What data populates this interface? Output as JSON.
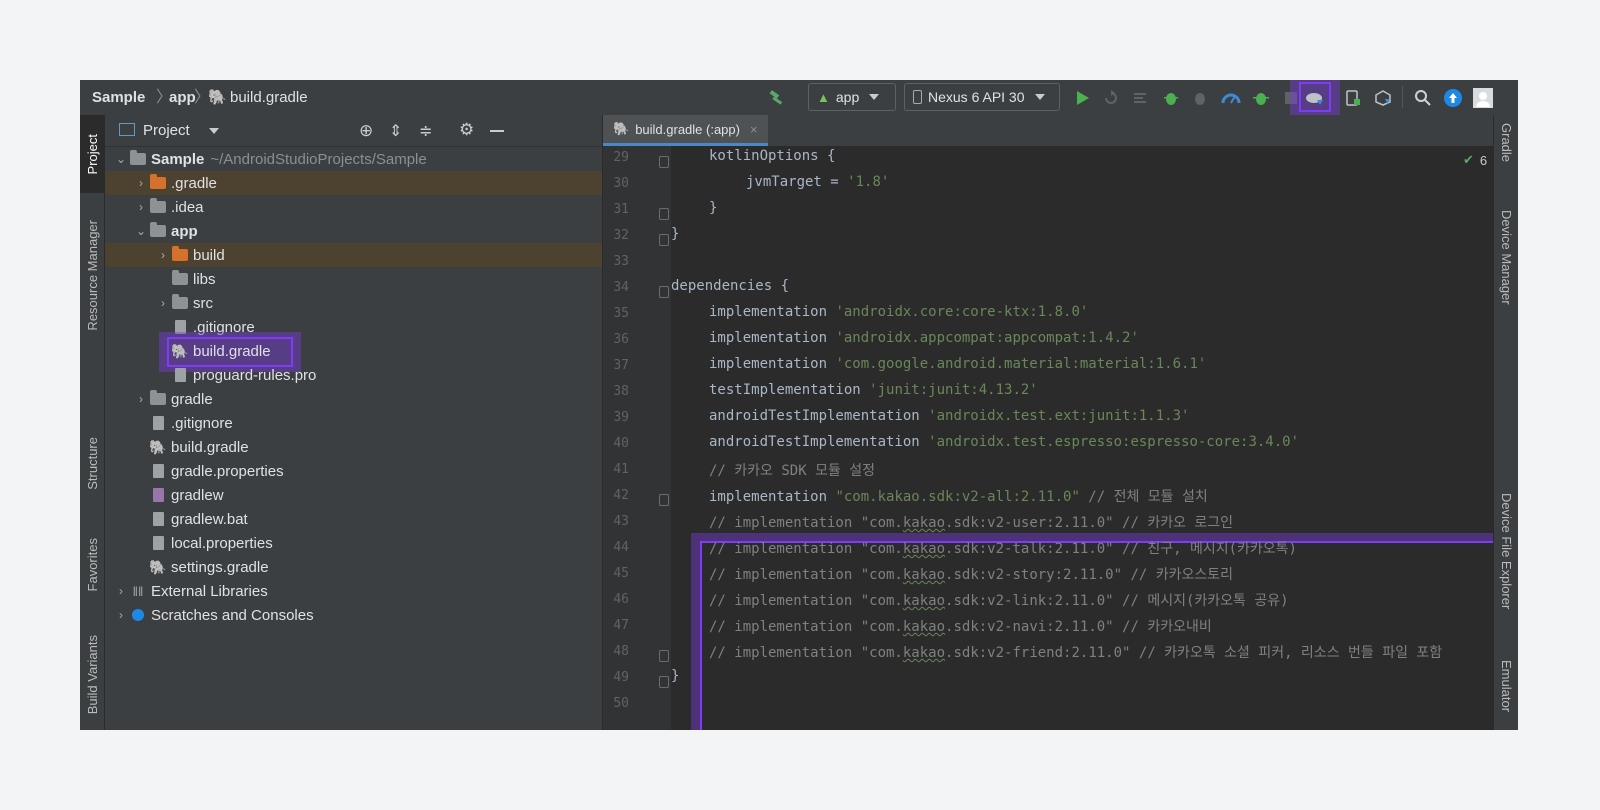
{
  "breadcrumbs": [
    "Sample",
    "app",
    "build.gradle"
  ],
  "toolbar": {
    "config_label": "app",
    "device_label": "Nexus 6 API 30"
  },
  "project_panel": {
    "title": "Project",
    "root": {
      "name": "Sample",
      "path": "~/AndroidStudioProjects/Sample"
    },
    "items": [
      {
        "label": ".gradle"
      },
      {
        "label": ".idea"
      },
      {
        "label": "app"
      },
      {
        "label": "build"
      },
      {
        "label": "libs"
      },
      {
        "label": "src"
      },
      {
        "label": ".gitignore"
      },
      {
        "label": "build.gradle"
      },
      {
        "label": "proguard-rules.pro"
      },
      {
        "label": "gradle"
      },
      {
        "label": ".gitignore"
      },
      {
        "label": "build.gradle"
      },
      {
        "label": "gradle.properties"
      },
      {
        "label": "gradlew"
      },
      {
        "label": "gradlew.bat"
      },
      {
        "label": "local.properties"
      },
      {
        "label": "settings.gradle"
      },
      {
        "label": "External Libraries"
      },
      {
        "label": "Scratches and Consoles"
      }
    ]
  },
  "left_tabs": [
    "Project",
    "Resource Manager",
    "Structure",
    "Favorites",
    "Build Variants"
  ],
  "right_tabs": [
    "Gradle",
    "Device Manager",
    "Device File Explorer",
    "Emulator"
  ],
  "editor": {
    "tab_label": "build.gradle (:app)",
    "inspection_count": "6",
    "line_numbers": [
      "29",
      "30",
      "31",
      "32",
      "33",
      "34",
      "35",
      "36",
      "37",
      "38",
      "39",
      "40",
      "41",
      "42",
      "43",
      "44",
      "45",
      "46",
      "47",
      "48",
      "49",
      "50"
    ],
    "lines": {
      "l29": "kotlinOptions {",
      "l30a": "jvmTarget = ",
      "l30b": "'1.8'",
      "l31": "}",
      "l32": "}",
      "l34": "dependencies {",
      "l35a": "implementation ",
      "l35b": "'androidx.core:core-ktx:1.8.0'",
      "l36a": "implementation ",
      "l36b": "'androidx.appcompat:appcompat:1.4.2'",
      "l37a": "implementation ",
      "l37b": "'com.google.android.material:material:1.6.1'",
      "l38a": "testImplementation ",
      "l38b": "'junit:junit:4.13.2'",
      "l39a": "androidTestImplementation ",
      "l39b": "'androidx.test.ext:junit:1.1.3'",
      "l40a": "androidTestImplementation ",
      "l40b": "'androidx.test.espresso:espresso-core:3.4.0'",
      "l41": "// 카카오 SDK 모듈 설정",
      "l42a": "implementation ",
      "l42b": "\"com.kakao.sdk:v2-all:2.11.0\"",
      "l42c": " // 전체 모듈 설치",
      "l43a": "// implementation \"com.",
      "l43b": "kakao",
      "l43c": ".sdk:v2-user:2.11.0\" // 카카오 로그인",
      "l44a": "// implementation \"com.",
      "l44b": "kakao",
      "l44c": ".sdk:v2-talk:2.11.0\" // 친구, 메시지(카카오톡)",
      "l45a": "// implementation \"com.",
      "l45b": "kakao",
      "l45c": ".sdk:v2-story:2.11.0\" // 카카오스토리",
      "l46a": "// implementation \"com.",
      "l46b": "kakao",
      "l46c": ".sdk:v2-link:2.11.0\" // 메시지(카카오톡 공유)",
      "l47a": "// implementation \"com.",
      "l47b": "kakao",
      "l47c": ".sdk:v2-navi:2.11.0\" // 카카오내비",
      "l48a": "// implementation \"com.",
      "l48b": "kakao",
      "l48c": ".sdk:v2-friend:2.11.0\" // 카카오톡 소셜 피커, 리소스 번들 파일 포함",
      "l49": "}"
    }
  },
  "colors": {
    "annotation": "#7f3bf5",
    "string": "#6a8759",
    "comment": "#808080",
    "keyword_text": "#a9b7c6",
    "run_green": "#4caf50",
    "highlight_row": "#4d4230"
  },
  "icons": [
    "hammer-icon",
    "android-icon",
    "phone-icon",
    "run-icon",
    "rerun-icon",
    "apply-changes-icon",
    "debug-icon",
    "attach-debugger-icon",
    "profile-icon",
    "debug-attach-icon",
    "stop-icon",
    "gradle-sync-icon",
    "device-manager-icon",
    "sdk-manager-icon",
    "search-icon",
    "update-icon",
    "avatar-icon"
  ]
}
